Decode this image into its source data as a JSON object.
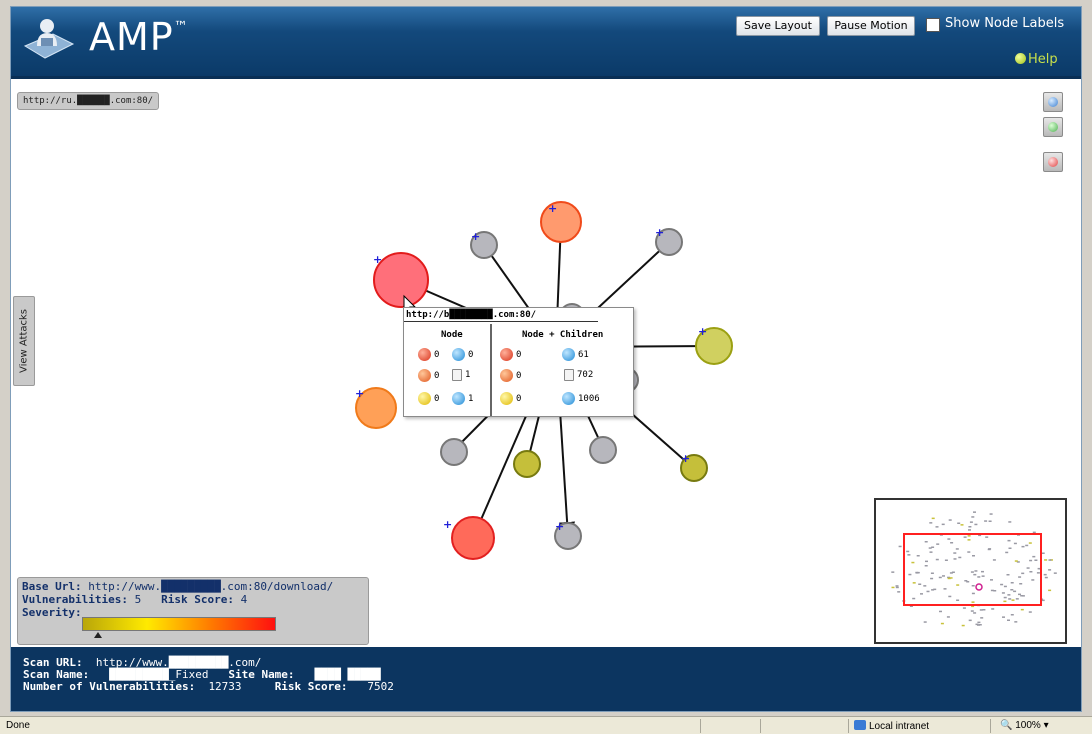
{
  "header": {
    "app_name": "AMP",
    "trademark": "™",
    "save_layout_label": "Save Layout",
    "pause_motion_label": "Pause Motion",
    "show_labels_label": "Show Node Labels",
    "help_label": "Help"
  },
  "canvas": {
    "current_url": "http://ru.██████.com:80/",
    "view_attacks_label": "View Attacks"
  },
  "tooltip": {
    "url": "http://b████████.com:80/",
    "node_header": "Node",
    "children_header": "Node + Children",
    "node_counts": {
      "critical": "0",
      "high": "0",
      "medium": "0",
      "info": "0",
      "pages": "1",
      "other": "1"
    },
    "children_counts": {
      "critical": "0",
      "high": "0",
      "medium": "0",
      "info": "61",
      "pages": "702",
      "other": "1006"
    }
  },
  "info_panel": {
    "base_url_label": "Base Url:",
    "base_url": "http://www.█████████.com:80/download/",
    "vulnerabilities_label": "Vulnerabilities:",
    "vulnerabilities": "5",
    "risk_score_label": "Risk Score:",
    "risk_score": "4",
    "severity_label": "Severity:",
    "severity_level": 0.08
  },
  "footer": {
    "scan_url_label": "Scan URL:",
    "scan_url": "http://www.█████████.com/",
    "scan_name_label": "Scan Name:",
    "scan_name": "█████████_Fixed",
    "site_name_label": "Site Name:",
    "site_name": "████ █████",
    "num_vuln_label": "Number of Vulnerabilities:",
    "num_vuln": "12733",
    "total_risk_label": "Risk Score:",
    "total_risk": "7502"
  },
  "statusbar": {
    "status": "Done",
    "zone": "Local intranet",
    "zoom": "100%"
  },
  "colors": {
    "header_blue": "#0b3a68",
    "node_red": "#ff6666",
    "node_orange": "#ff9a50",
    "node_olive": "#c8c24a",
    "node_gray": "#b7b7bd"
  }
}
